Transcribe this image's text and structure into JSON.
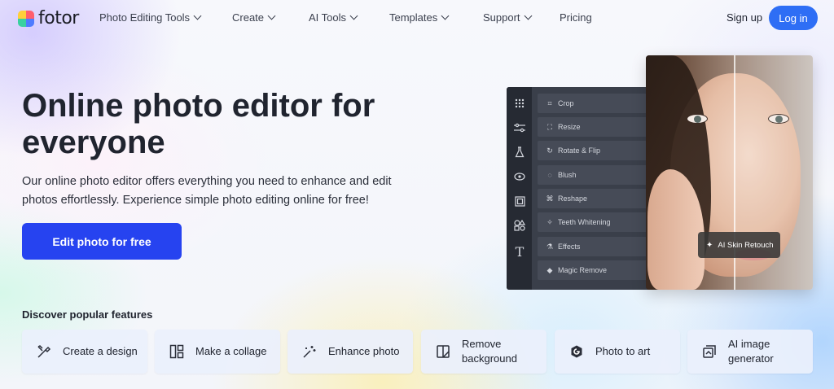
{
  "brand": {
    "name": "fotor"
  },
  "nav": {
    "items": [
      {
        "label": "Photo Editing Tools",
        "dropdown": true
      },
      {
        "label": "Create",
        "dropdown": true
      },
      {
        "label": "AI Tools",
        "dropdown": true
      },
      {
        "label": "Templates",
        "dropdown": true
      },
      {
        "label": "Support",
        "dropdown": true
      },
      {
        "label": "Pricing",
        "dropdown": false
      }
    ],
    "signup_label": "Sign up",
    "login_label": "Log in"
  },
  "hero": {
    "title": "Online photo editor for everyone",
    "description": "Our online photo editor offers everything you need to enhance and edit photos effortlessly. Experience simple photo editing online for free!",
    "cta_label": "Edit photo for free"
  },
  "editor_mock": {
    "toolbar_icons": [
      "grid-icon",
      "sliders-icon",
      "flask-icon",
      "eye-icon",
      "frame-icon",
      "shapes-icon",
      "text-icon"
    ],
    "tools": [
      {
        "label": "Crop",
        "icon": "crop-icon"
      },
      {
        "label": "Resize",
        "icon": "resize-icon"
      },
      {
        "label": "Rotate & Flip",
        "icon": "rotate-icon"
      },
      {
        "label": "Blush",
        "icon": "blush-icon"
      },
      {
        "label": "Reshape",
        "icon": "reshape-icon"
      },
      {
        "label": "Teeth Whitening",
        "icon": "teeth-icon"
      },
      {
        "label": "Effects",
        "icon": "effects-icon"
      },
      {
        "label": "Magic Remove",
        "icon": "eraser-icon"
      }
    ],
    "badge_label": "AI Skin Retouch"
  },
  "features": {
    "title": "Discover popular features",
    "cards": [
      {
        "label": "Create a design",
        "icon": "design-icon"
      },
      {
        "label": "Make a collage",
        "icon": "collage-icon"
      },
      {
        "label": "Enhance photo",
        "icon": "enhance-icon"
      },
      {
        "label": "Remove background",
        "icon": "remove-bg-icon"
      },
      {
        "label": "Photo to art",
        "icon": "art-icon"
      },
      {
        "label": "AI image generator",
        "icon": "ai-image-icon"
      }
    ]
  },
  "colors": {
    "accent": "#2e6ef5",
    "cta": "#2643f0",
    "editor_panel": "#3a3f4a",
    "editor_toolbar": "#262a33"
  }
}
